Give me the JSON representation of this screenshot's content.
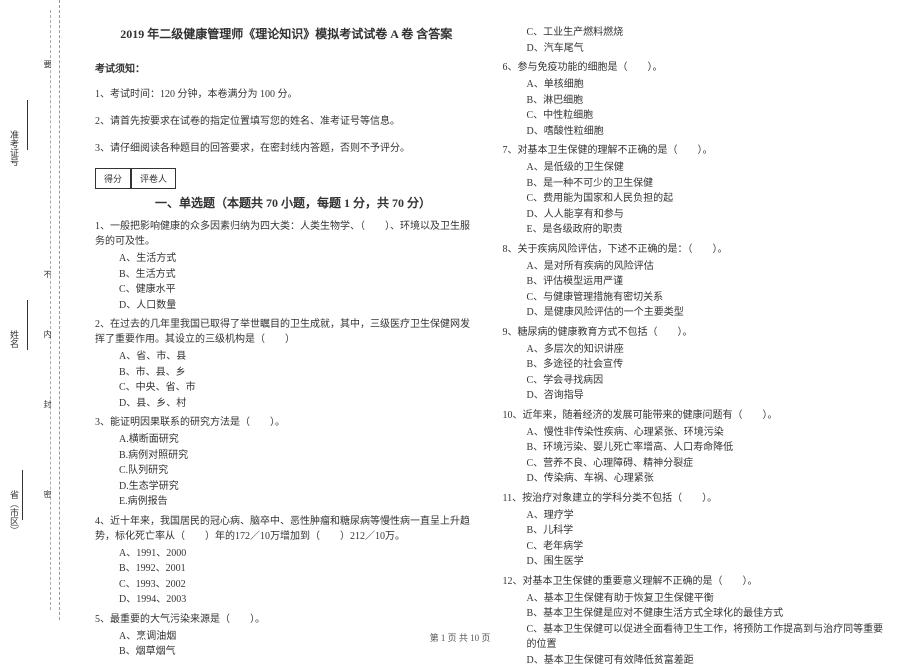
{
  "title": "2019 年二级健康管理师《理论知识》模拟考试试卷 A 卷  含答案",
  "notice_header": "考试须知：",
  "notices": [
    "1、考试时间：120 分钟，本卷满分为 100 分。",
    "2、请首先按要求在试卷的指定位置填写您的姓名、准考证号等信息。",
    "3、请仔细阅读各种题目的回答要求，在密封线内答题，否则不予评分。"
  ],
  "score_labels": {
    "score": "得分",
    "reviewer": "评卷人"
  },
  "section1_title": "一、单选题（本题共 70 小题，每题 1 分，共 70 分）",
  "sidebar": {
    "province": "省（市区）",
    "name": "姓名",
    "id": "准考证号",
    "marks": {
      "seal": "密",
      "line": "封",
      "inner": "内",
      "not": "不",
      "outer": "要"
    }
  },
  "q_left": [
    {
      "stem": "1、一般把影响健康的众多因素归纳为四大类：人类生物学、（　　）、环境以及卫生服务的可及性。",
      "options": [
        "A、生活方式",
        "B、生活方式",
        "C、健康水平",
        "D、人口数量"
      ]
    },
    {
      "stem": "2、在过去的几年里我国已取得了举世瞩目的卫生成就，其中，三级医疗卫生保健网发挥了重要作用。其设立的三级机构是（　　）",
      "options": [
        "A、省、市、县",
        "B、市、县、乡",
        "C、中央、省、市",
        "D、县、乡、村"
      ]
    },
    {
      "stem": "3、能证明因果联系的研究方法是（　　）。",
      "options": [
        "A.横断面研究",
        "B.病例对照研究",
        "C.队列研究",
        "D.生态学研究",
        "E.病例报告"
      ]
    },
    {
      "stem": "4、近十年来，我国居民的冠心病、脑卒中、恶性肿瘤和糖尿病等慢性病一直呈上升趋势，标化死亡率从（　　）年的172／10万增加到（　　）212／10万。",
      "options": [
        "A、1991、2000",
        "B、1992、2001",
        "C、1993、2002",
        "D、1994、2003"
      ]
    },
    {
      "stem": "5、最重要的大气污染来源是（　　）。",
      "options": [
        "A、烹调油烟",
        "B、烟草烟气"
      ]
    }
  ],
  "q_right_continue": [
    "C、工业生产燃料燃烧",
    "D、汽车尾气"
  ],
  "q_right": [
    {
      "stem": "6、参与免疫功能的细胞是（　　）。",
      "options": [
        "A、单核细胞",
        "B、淋巴细胞",
        "C、中性粒细胞",
        "D、嗜酸性粒细胞"
      ]
    },
    {
      "stem": "7、对基本卫生保健的理解不正确的是（　　）。",
      "options": [
        "A、是低级的卫生保健",
        "B、是一种不可少的卫生保健",
        "C、费用能为国家和人民负担的起",
        "D、人人能享有和参与",
        "E、是各级政府的职责"
      ]
    },
    {
      "stem": "8、关于疾病风险评估，下述不正确的是：（　　）。",
      "options": [
        "A、是对所有疾病的风险评估",
        "B、评估模型运用严谨",
        "C、与健康管理措施有密切关系",
        "D、是健康风险评估的一个主要类型"
      ]
    },
    {
      "stem": "9、糖尿病的健康教育方式不包括（　　）。",
      "options": [
        "A、多层次的知识讲座",
        "B、多途径的社会宣传",
        "C、学会寻找病因",
        "D、咨询指导"
      ]
    },
    {
      "stem": "10、近年来，随着经济的发展可能带来的健康问题有（　　）。",
      "options": [
        "A、慢性非传染性疾病、心理紧张、环境污染",
        "B、环境污染、婴儿死亡率增高、人口寿命降低",
        "C、营养不良、心理障碍、精神分裂症",
        "D、传染病、车祸、心理紧张"
      ]
    },
    {
      "stem": "11、按治疗对象建立的学科分类不包括（　　）。",
      "options": [
        "A、理疗学",
        "B、儿科学",
        "C、老年病学",
        "D、围生医学"
      ]
    },
    {
      "stem": "12、对基本卫生保健的重要意义理解不正确的是（　　）。",
      "options": [
        "A、基本卫生保健有助于恢复卫生保健平衡",
        "B、基本卫生保健是应对不健康生活方式全球化的最佳方式",
        "C、基本卫生保健可以促进全面看待卫生工作，将预防工作提高到与治疗同等重要的位置",
        "D、基本卫生保健可有效降低贫富差距"
      ]
    }
  ],
  "footer": "第 1 页 共 10 页"
}
